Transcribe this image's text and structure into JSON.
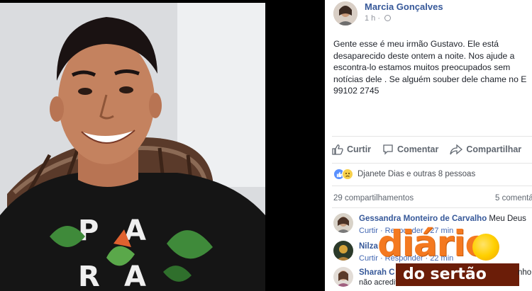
{
  "post": {
    "author": "Marcia Gonçalves",
    "time": "1 h",
    "text": "Gente esse é meu irmão Gustavo. Ele está\ndesaparecido deste ontem a noite. Nos ajude a\nescontra-lo estamos muitos preocupados sem\nnotícias dele . Se alguém souber dele chame no E\n99102 2745"
  },
  "actions": {
    "like": "Curtir",
    "comment": "Comentar",
    "share": "Compartilhar"
  },
  "reactions": {
    "text": "Djanete Dias e outras 8 pessoas",
    "icons": [
      "like-icon",
      "sad-icon"
    ]
  },
  "stats": {
    "shares": "29 compartilhamentos",
    "comments": "5 comentá"
  },
  "comments": [
    {
      "name": "Gessandra Monteiro de Carvalho",
      "text": "Meu Deus",
      "reply_label": "Curtir · Responder · 27 min"
    },
    {
      "name": "Nilza",
      "text": "",
      "reply_label": "Curtir · Responder · 22 min"
    },
    {
      "name": "Sharah C",
      "text": "nho",
      "sub": "não acredito"
    }
  ],
  "watermark": {
    "main": "diário",
    "sub": "do sertão"
  },
  "colors": {
    "link": "#365899",
    "brand_orange": "#f47920",
    "brand_brown": "#6b1d08"
  }
}
